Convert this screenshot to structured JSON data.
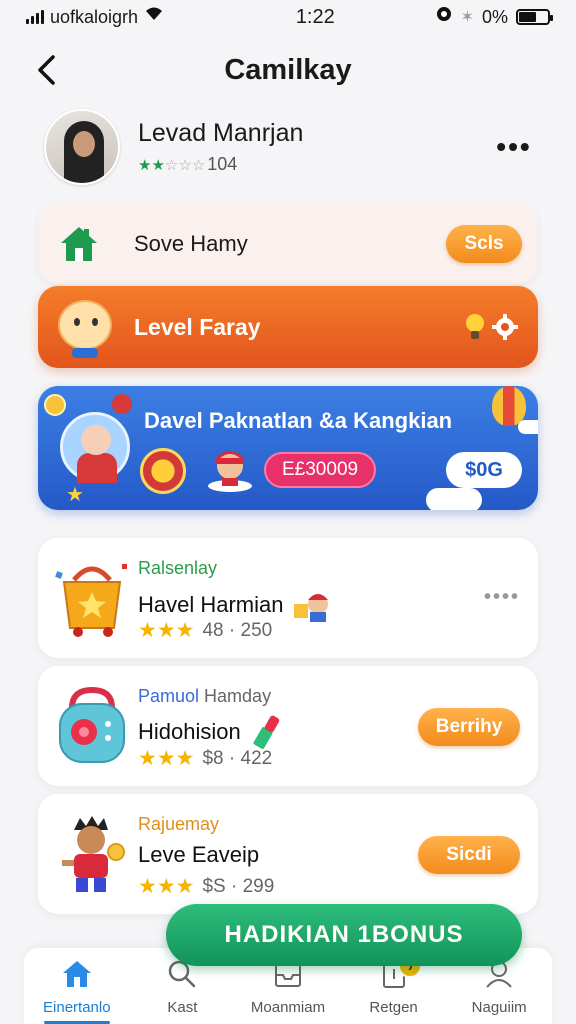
{
  "status_bar": {
    "carrier": "uofkaloigrh",
    "time": "1:22",
    "battery_percent": "0%",
    "icons": [
      "signal-icon",
      "wifi-icon",
      "alarm-icon",
      "bluetooth-icon",
      "battery-icon"
    ],
    "battery_level": 0.6
  },
  "header": {
    "title": "Camilkay",
    "back_icon": "chevron-left-icon"
  },
  "profile": {
    "name": "Levad Manrjan",
    "rating_stars": 2,
    "rating_count": "104",
    "more_icon": "more-horizontal-icon"
  },
  "save_card": {
    "label": "Sove Hamy",
    "button_label": "Scls",
    "icon": "house-icon"
  },
  "level_card": {
    "label": "Level Faray",
    "icons": [
      "lightbulb-icon",
      "gear-icon"
    ]
  },
  "banner": {
    "title": "Davel Paknatlan &a Kangkian",
    "code": "E£30009",
    "price": "$0G"
  },
  "list_items": [
    {
      "category": "Ralsenlay",
      "title": "Havel Harmian",
      "stars": 3,
      "rating": "48 · 250",
      "action": "more",
      "category_color": "#2a9d4a",
      "icon": "shopping-basket-icon"
    },
    {
      "category": "Pamuol",
      "category_extra": "Hamday",
      "title": "Hidohision",
      "stars": 3,
      "rating": "$8 · 422",
      "action_label": "Berrihy",
      "category_color": "#3a6ad4",
      "icon": "radio-icon"
    },
    {
      "category": "Rajuemay",
      "title": "Leve Eaveip",
      "stars": 3,
      "rating": "$S · 299",
      "action_label": "Sicdi",
      "category_color": "#e0901a",
      "icon": "character-icon"
    }
  ],
  "bonus_button": {
    "label": "HADIKIAN 1BONUS"
  },
  "tab_bar": {
    "tabs": [
      {
        "label": "Einertanlo",
        "icon": "home-icon",
        "active": true
      },
      {
        "label": "Kast",
        "icon": "search-icon",
        "active": false
      },
      {
        "label": "Moanmiam",
        "icon": "inbox-icon",
        "active": false
      },
      {
        "label": "Retgen",
        "icon": "document-icon",
        "active": false,
        "badge": "›"
      },
      {
        "label": "Naguiim",
        "icon": "user-icon",
        "active": false
      }
    ]
  },
  "colors": {
    "accent_orange": "#f28c1c",
    "level_orange": "#e2551c",
    "banner_blue": "#2459c8",
    "bonus_green": "#12935a",
    "active_tab": "#1d7fd0",
    "star_gold": "#f5b400"
  }
}
